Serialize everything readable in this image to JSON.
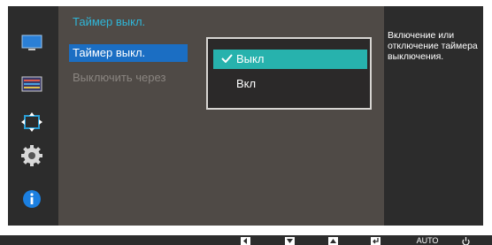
{
  "sidebar": {
    "items": [
      {
        "icon": "picture-icon"
      },
      {
        "icon": "onscreen-display-icon"
      },
      {
        "icon": "position-size-icon"
      },
      {
        "icon": "settings-gear-icon"
      },
      {
        "icon": "information-icon"
      }
    ]
  },
  "panel": {
    "title": "Таймер выкл.",
    "items": [
      {
        "label": "Таймер выкл."
      },
      {
        "label": "Выключить через"
      }
    ]
  },
  "dropdown": {
    "options": [
      {
        "label": "Выкл",
        "checked": true
      },
      {
        "label": "Вкл",
        "checked": false
      }
    ]
  },
  "info": {
    "text": "Включение или отключение таймера выключения."
  },
  "bottom_bar": {
    "auto_label": "AUTO",
    "buttons": [
      "left-arrow-icon",
      "down-arrow-icon",
      "up-arrow-icon",
      "enter-icon",
      "auto-button",
      "power-icon"
    ]
  },
  "colors": {
    "accent_teal": "#27b2ad",
    "selection_blue": "#1b6ec3",
    "title_cyan": "#2fb6d8"
  }
}
